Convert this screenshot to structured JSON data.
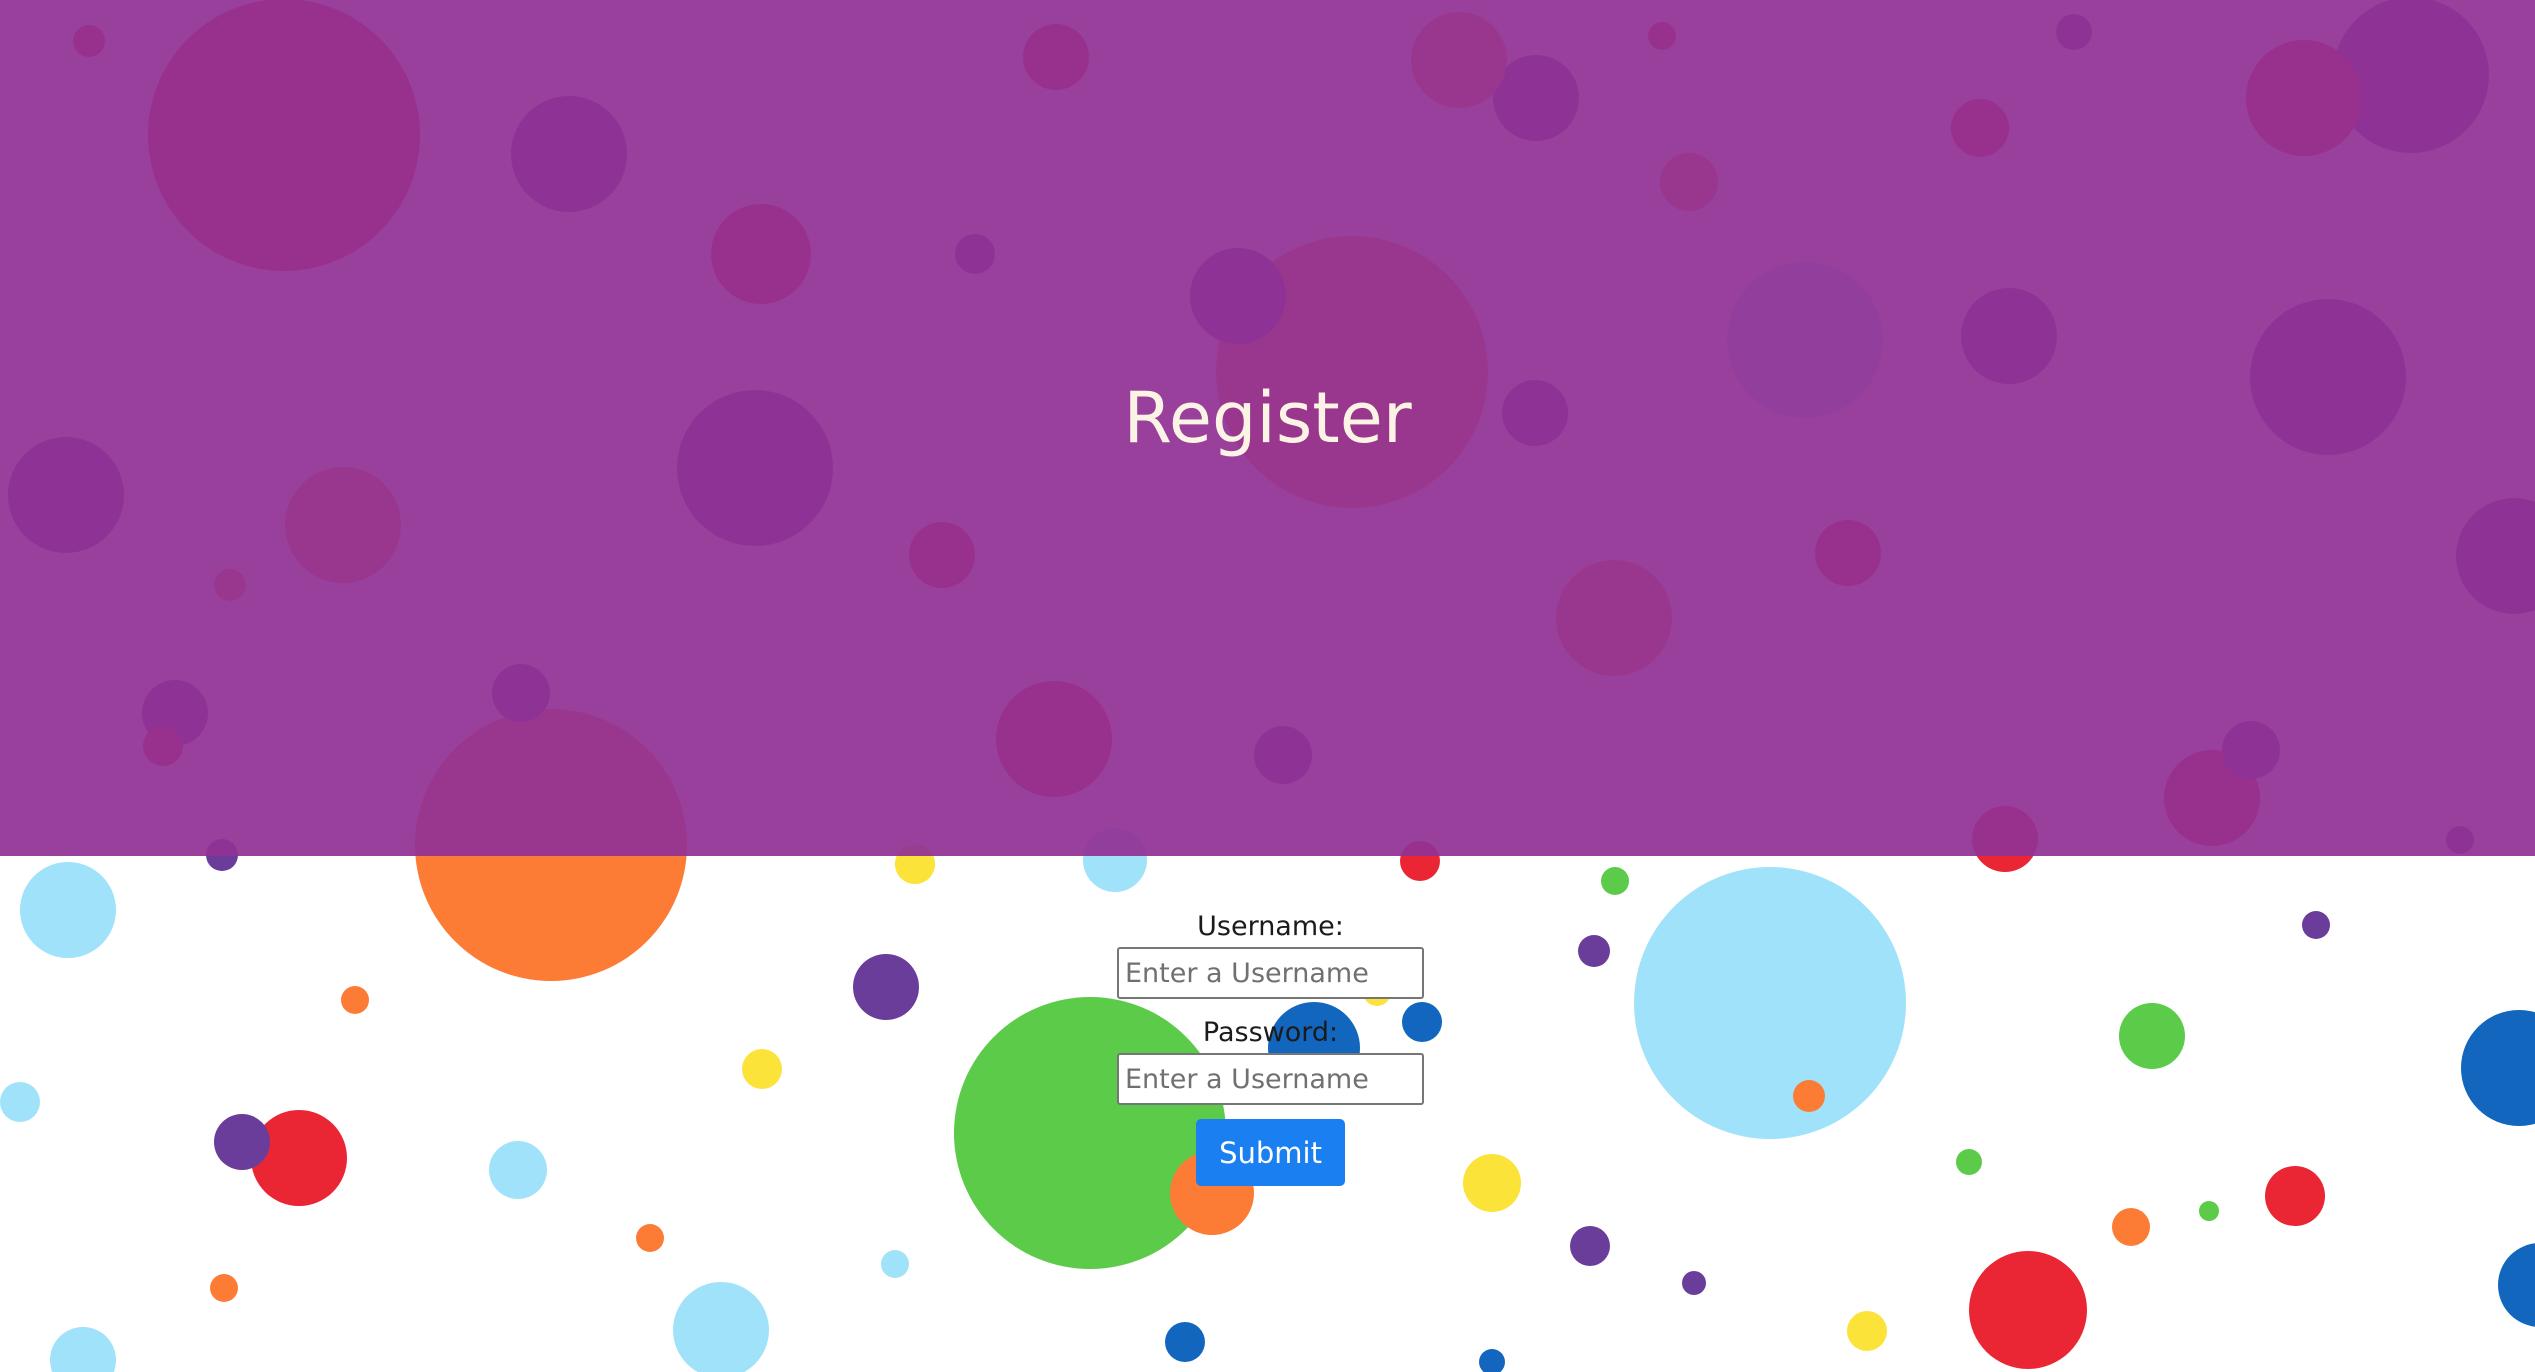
{
  "header": {
    "title": "Register"
  },
  "form": {
    "username_label": "Username:",
    "username_placeholder": "Enter a Username",
    "password_label": "Password:",
    "password_placeholder": "Enter a Username",
    "submit_label": "Submit"
  },
  "colors": {
    "header_overlay": "#913296",
    "title_text": "#fbf3e4",
    "submit_button": "#1a7ff0",
    "dot_palette": [
      "#a0e2fa",
      "#fd7c35",
      "#5bcb49",
      "#6a3d9a",
      "#ea2634",
      "#fbe33a",
      "#1366bd"
    ]
  }
}
